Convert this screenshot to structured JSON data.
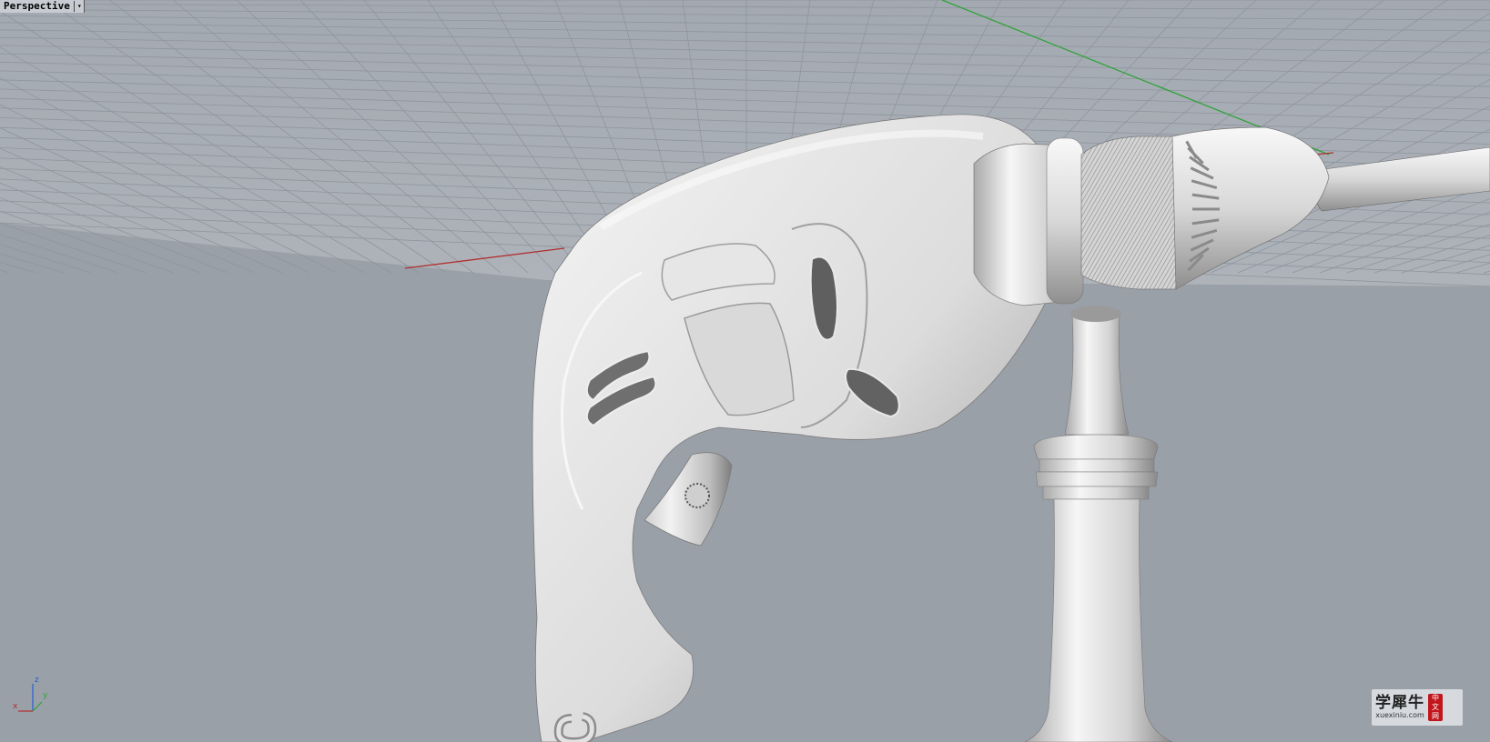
{
  "viewport": {
    "title": "Perspective",
    "menu_caret": "▾",
    "background_color": "#9aa0a8",
    "grid_color": "#8e949c",
    "axis_colors": {
      "x": "#b03030",
      "y": "#2fa33a",
      "z": "#2a5fd0"
    }
  },
  "axis_widget": {
    "z_label": "z",
    "x_label": "x",
    "y_label": "y"
  },
  "model": {
    "name": "electric drill",
    "icon": "drill-model"
  },
  "watermark": {
    "chinese": "学犀牛",
    "url": "xuexiniu.com",
    "seal": [
      "中",
      "文",
      "网"
    ]
  }
}
